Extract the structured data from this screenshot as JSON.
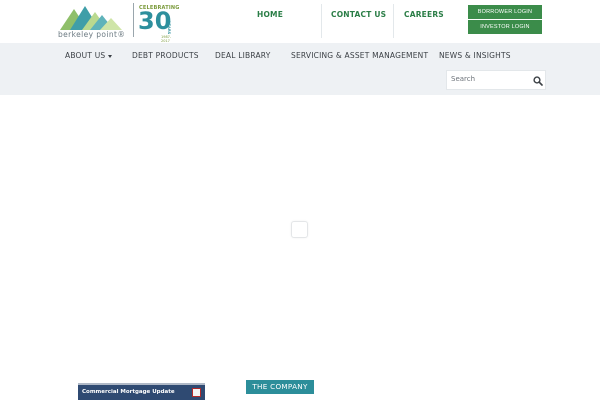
{
  "brand": {
    "wordmark": "berkeley point®",
    "badge_celebrating": "CELEBRATING",
    "badge_number": "30",
    "badge_years": "YEARS",
    "badge_dates": "1987-2017",
    "colors": {
      "green": "#3b8c4a",
      "teal": "#2c8e9a",
      "nav_bg": "#eef1f4"
    }
  },
  "top_nav": {
    "home": "HOME",
    "contact": "CONTACT US",
    "careers": "CAREERS"
  },
  "logins": {
    "borrower": "BORROWER LOGIN",
    "investor": "INVESTOR LOGIN"
  },
  "main_nav": {
    "about": "ABOUT US",
    "debt": "DEBT PRODUCTS",
    "deal": "DEAL LIBRARY",
    "servicing": "SERVICING & ASSET MANAGEMENT",
    "news": "NEWS & INSIGHTS"
  },
  "search": {
    "placeholder": "Search",
    "icon": "magnifier-icon"
  },
  "widget": {
    "label": "Commercial Mortgage Update"
  },
  "sections": {
    "company": "THE COMPANY"
  }
}
